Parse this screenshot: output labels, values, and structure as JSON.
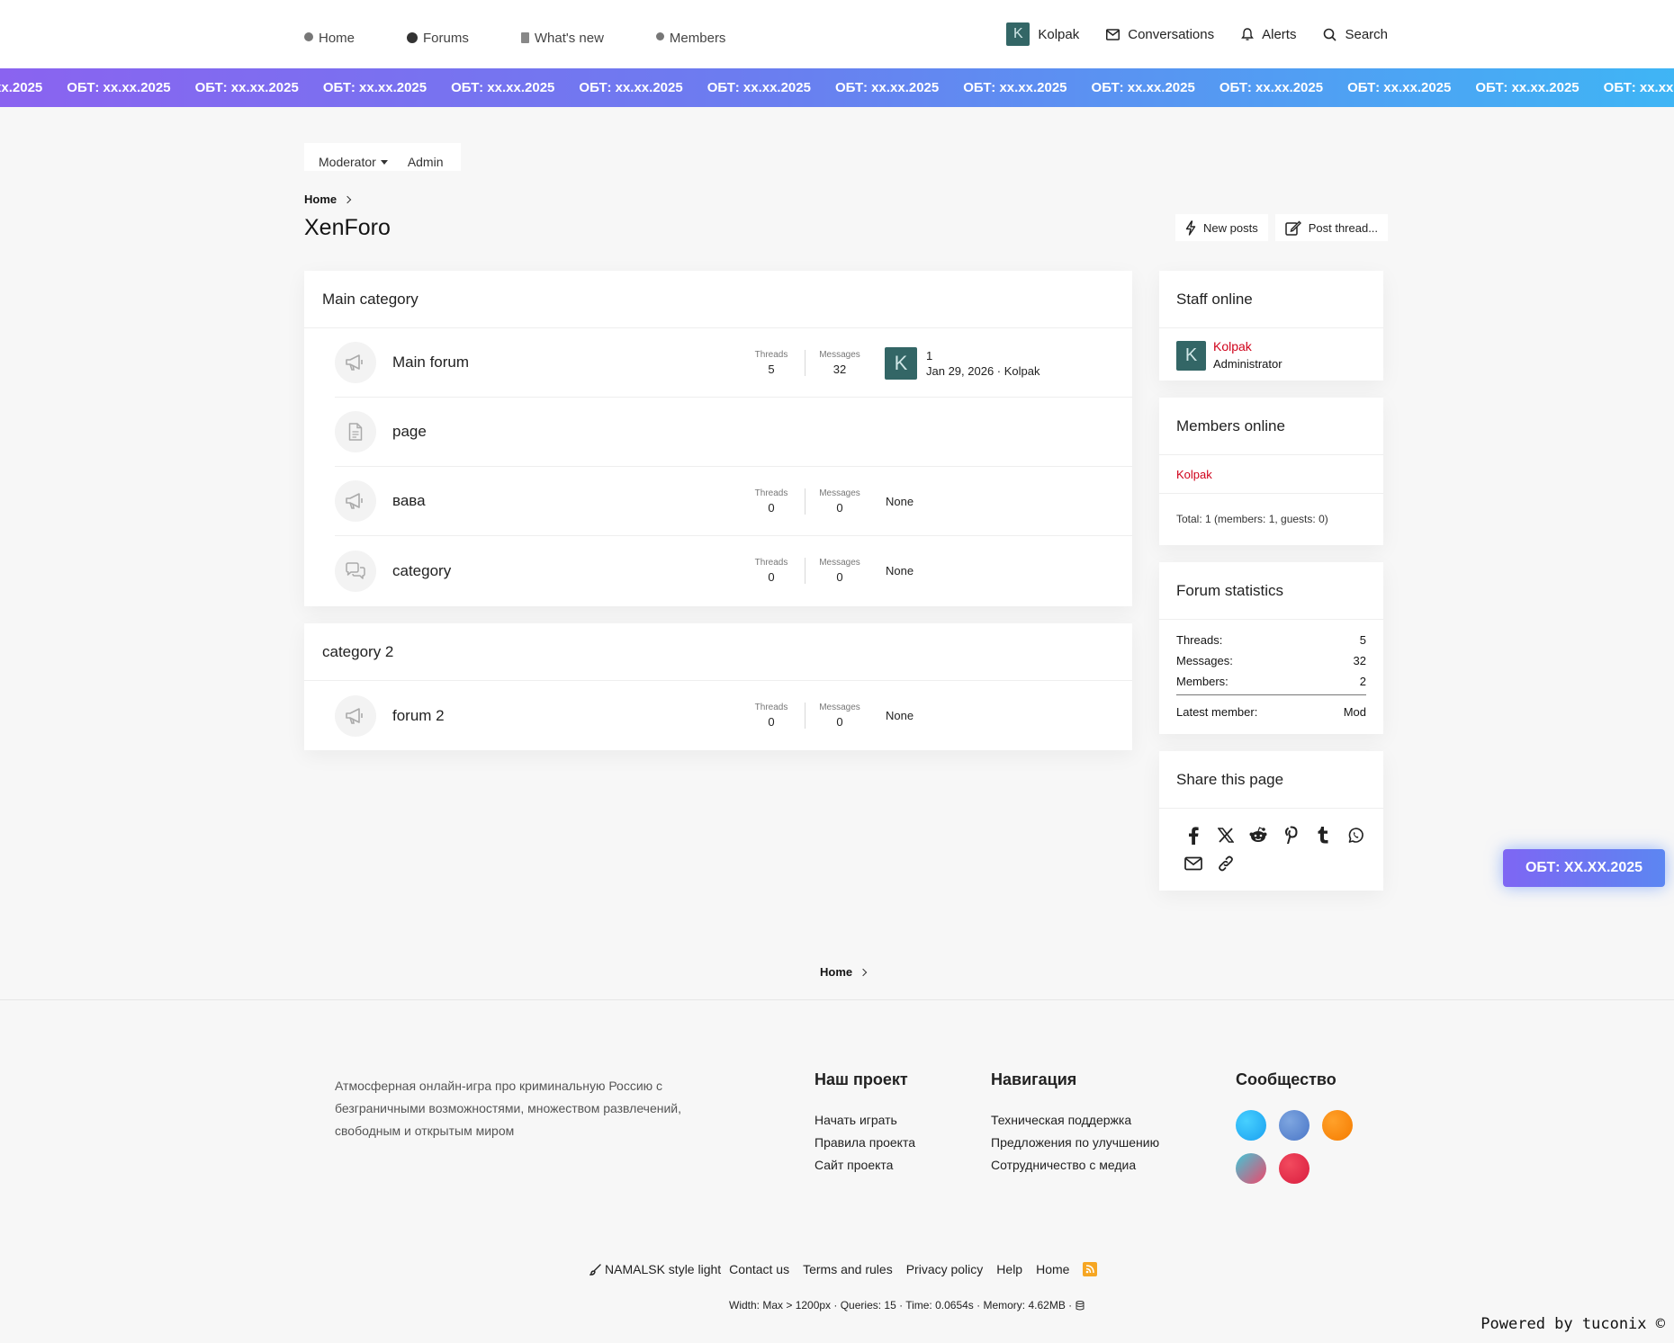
{
  "header": {
    "nav_tabs": [
      {
        "label": "Home",
        "icon": "home-icon"
      },
      {
        "label": "Forums",
        "icon": "forums-icon"
      },
      {
        "label": "What's new",
        "icon": "file-icon"
      },
      {
        "label": "Members",
        "icon": "members-icon"
      }
    ],
    "user": {
      "avatar_letter": "K",
      "name": "Kolpak"
    },
    "conversations": "Conversations",
    "alerts": "Alerts",
    "search": "Search"
  },
  "marquee": {
    "item_text": "ОБТ: xx.xx.2025",
    "colors": {
      "start": "#8a63f0",
      "end": "#3fb5f5"
    }
  },
  "staff_bar": {
    "moderator": "Moderator",
    "admin": "Admin"
  },
  "breadcrumb": {
    "home": "Home"
  },
  "page_title": "XenForo",
  "buttons": {
    "new_posts": "New posts",
    "post_thread": "Post thread..."
  },
  "categories": [
    {
      "title": "Main category",
      "nodes": [
        {
          "title": "Main forum",
          "icon": "megaphone-icon",
          "threads_label": "Threads",
          "threads": "5",
          "messages_label": "Messages",
          "messages": "32",
          "last_post": {
            "avatar_letter": "K",
            "title": "1",
            "meta": "Jan 29, 2026 · Kolpak"
          }
        },
        {
          "title": "page",
          "icon": "page-icon"
        },
        {
          "title": "вава",
          "icon": "megaphone-icon",
          "threads_label": "Threads",
          "threads": "0",
          "messages_label": "Messages",
          "messages": "0",
          "none": "None"
        },
        {
          "title": "category",
          "icon": "chat-bubbles-icon",
          "threads_label": "Threads",
          "threads": "0",
          "messages_label": "Messages",
          "messages": "0",
          "none": "None"
        }
      ]
    },
    {
      "title": "category 2",
      "nodes": [
        {
          "title": "forum 2",
          "icon": "megaphone-icon",
          "threads_label": "Threads",
          "threads": "0",
          "messages_label": "Messages",
          "messages": "0",
          "none": "None"
        }
      ]
    }
  ],
  "sidebar": {
    "staff_online": {
      "title": "Staff online",
      "avatar_letter": "K",
      "name": "Kolpak",
      "role": "Administrator"
    },
    "members_online": {
      "title": "Members online",
      "member": "Kolpak",
      "total": "Total: 1 (members: 1, guests: 0)"
    },
    "forum_statistics": {
      "title": "Forum statistics",
      "threads_label": "Threads:",
      "threads": "5",
      "messages_label": "Messages:",
      "messages": "32",
      "members_label": "Members:",
      "members": "2",
      "latest_label": "Latest member:",
      "latest": "Mod"
    },
    "share": {
      "title": "Share this page",
      "icons": [
        "facebook-icon",
        "x-icon",
        "reddit-icon",
        "pinterest-icon",
        "tumblr-icon",
        "whatsapp-icon",
        "email-icon",
        "link-icon"
      ]
    }
  },
  "float_button": "ОБТ: XX.XX.2025",
  "footer": {
    "breadcrumb_home": "Home",
    "description": "Атмосферная онлайн-игра про криминальную Россию с безграничными возможностями, множеством развлечений, свободным и открытым миром",
    "project": {
      "title": "Наш проект",
      "links": [
        "Начать играть",
        "Правила проекта",
        "Сайт проекта"
      ]
    },
    "navigation": {
      "title": "Навигация",
      "links": [
        "Техническая поддержка",
        "Предложения по улучшению",
        "Сотрудничество с медиа"
      ]
    },
    "community": {
      "title": "Сообщество"
    },
    "links": {
      "style": "NAMALSK style light",
      "contact": "Contact us",
      "terms": "Terms and rules",
      "privacy": "Privacy policy",
      "help": "Help",
      "home": "Home"
    },
    "debug": "Width: Max > 1200px · Queries: 15 · Time: 0.0654s · Memory: 4.62MB ·",
    "powered": "Powered by tuconix ©"
  },
  "colors": {
    "accent_red": "#d0021b",
    "avatar": "#336666"
  }
}
